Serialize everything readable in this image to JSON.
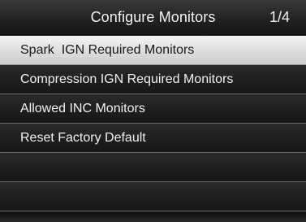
{
  "header": {
    "title": "Configure Monitors",
    "page_indicator": "1/4"
  },
  "menu": {
    "selected_index": 0,
    "items": [
      {
        "label": "Spark  IGN Required Monitors"
      },
      {
        "label": "Compression IGN Required Monitors"
      },
      {
        "label": "Allowed INC Monitors"
      },
      {
        "label": "Reset Factory Default"
      },
      {
        "label": ""
      },
      {
        "label": ""
      }
    ]
  }
}
